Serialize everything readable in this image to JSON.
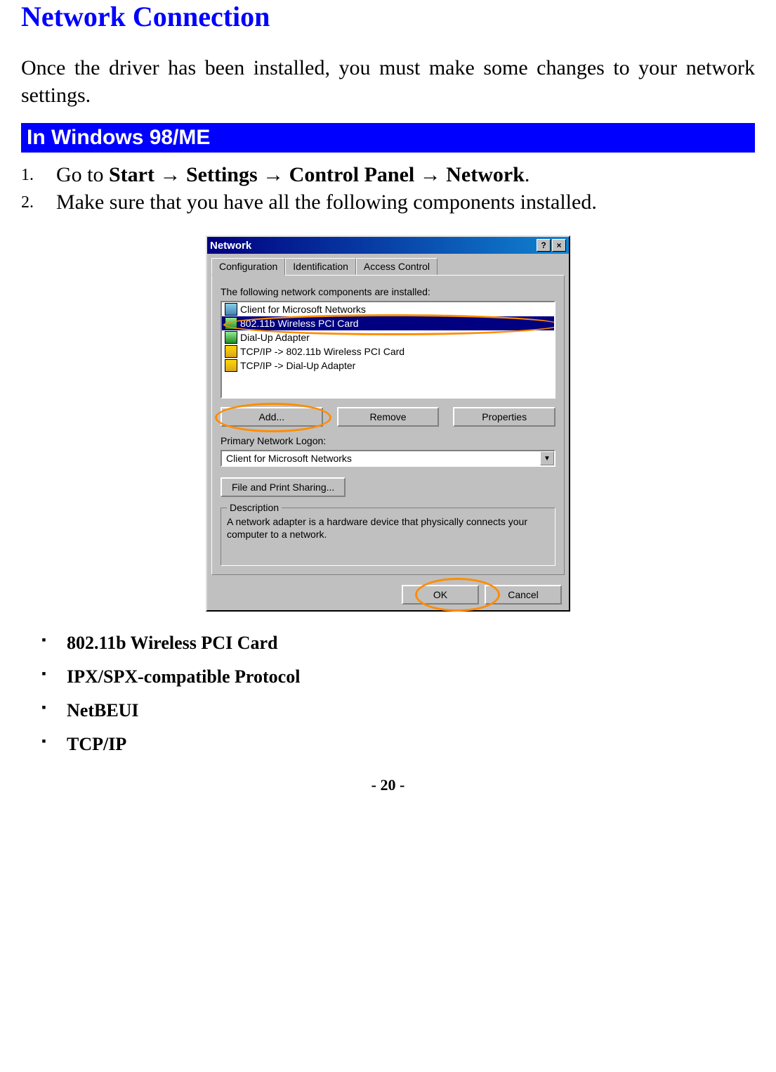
{
  "heading": "Network Connection",
  "intro": "Once the driver has been installed, you must make some changes to your network settings.",
  "section_heading": "In Windows 98/ME",
  "steps": {
    "s1": {
      "num": "1.",
      "prefix": "Go to ",
      "path": "Start → Settings → Control Panel → Network",
      "suffix": "."
    },
    "s2": {
      "num": "2.",
      "text": "Make sure that you have all the following components installed."
    }
  },
  "dialog": {
    "title": "Network",
    "help_btn": "?",
    "close_btn": "×",
    "tabs": {
      "t1": "Configuration",
      "t2": "Identification",
      "t3": "Access Control"
    },
    "components_label": "The following network components are installed:",
    "components": {
      "c1": "Client for Microsoft Networks",
      "c2": "802.11b Wireless  PCI Card",
      "c3": "Dial-Up Adapter",
      "c4": "TCP/IP -> 802.11b Wireless  PCI Card",
      "c5": "TCP/IP -> Dial-Up Adapter"
    },
    "buttons": {
      "add": "Add...",
      "remove": "Remove",
      "properties": "Properties"
    },
    "logon_label": "Primary Network Logon:",
    "logon_value": "Client for Microsoft Networks",
    "share_btn": "File and Print Sharing...",
    "desc_label": "Description",
    "desc_text": "A network adapter is a hardware device that physically connects your computer to a network.",
    "ok": "OK",
    "cancel": "Cancel"
  },
  "bullets": {
    "b1": "802.11b Wireless PCI Card",
    "b2": "IPX/SPX-compatible Protocol",
    "b3": "NetBEUI",
    "b4": "TCP/IP"
  },
  "page_num": "- 20 -"
}
